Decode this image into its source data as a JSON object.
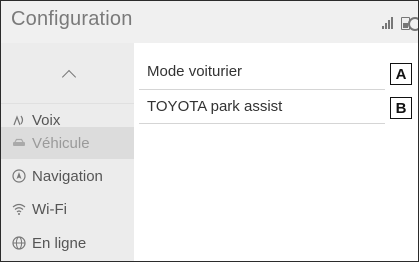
{
  "header": {
    "title": "Configuration"
  },
  "sidebar": {
    "items": [
      {
        "label": "Voix",
        "icon": "voice-icon"
      },
      {
        "label": "Véhicule",
        "icon": "car-icon"
      },
      {
        "label": "Navigation",
        "icon": "navigation-icon"
      },
      {
        "label": "Wi-Fi",
        "icon": "wifi-icon"
      },
      {
        "label": "En ligne",
        "icon": "globe-icon"
      }
    ],
    "selected": "Véhicule"
  },
  "main": {
    "rows": [
      {
        "label": "Mode voiturier",
        "callout": "A"
      },
      {
        "label": "TOYOTA park assist",
        "callout": "B"
      }
    ]
  },
  "colors": {
    "header_bg": "#f0f0f0",
    "sidebar_bg": "#ececec",
    "selected_bg": "#dcdcdc"
  }
}
